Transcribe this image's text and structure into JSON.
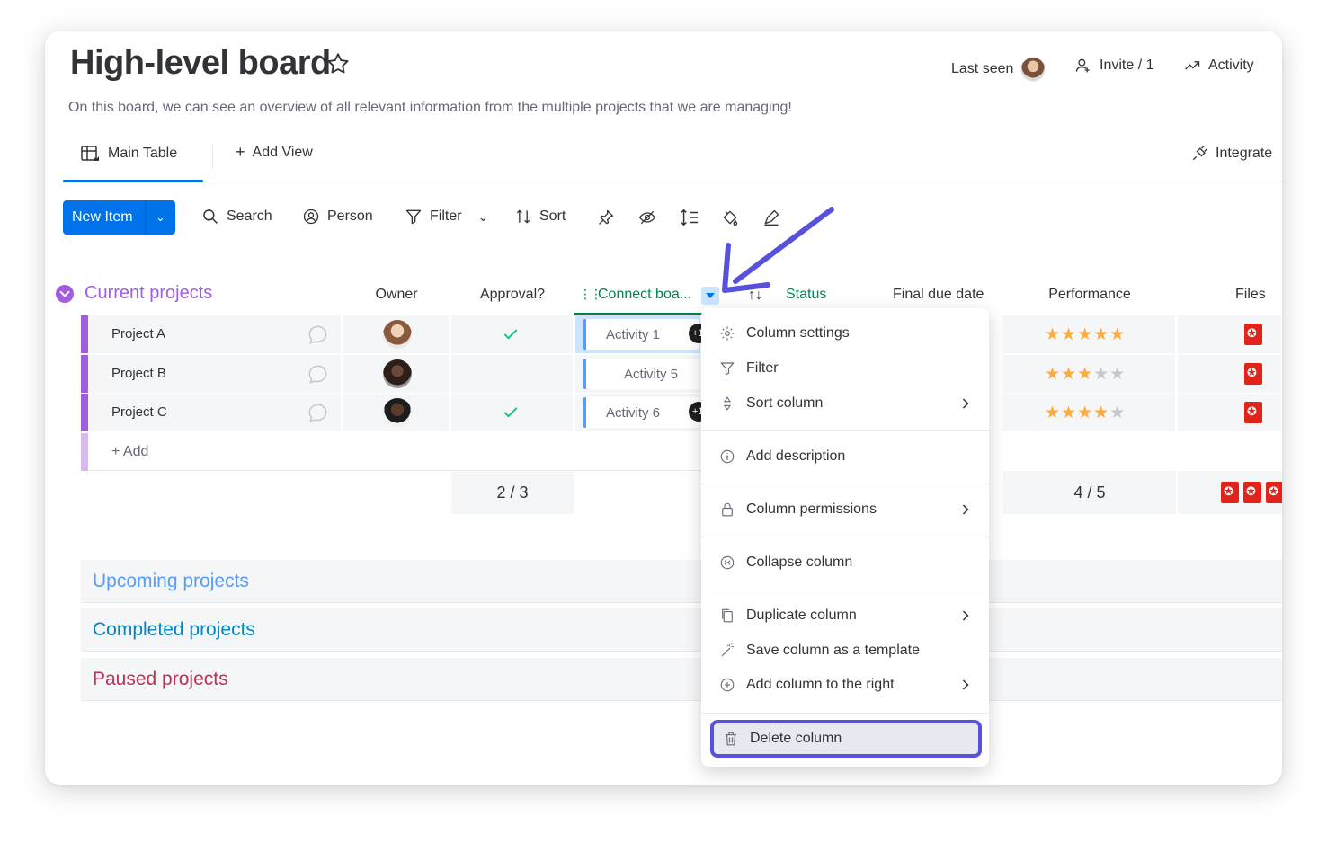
{
  "board": {
    "title": "High-level board",
    "description": "On this board, we can see an overview of all relevant information from the multiple projects that we are managing!"
  },
  "header": {
    "last_seen": "Last seen",
    "invite": "Invite / 1",
    "activity": "Activity",
    "integrate": "Integrate"
  },
  "tabs": {
    "main_table": "Main Table",
    "add_view": "Add View"
  },
  "toolbar": {
    "new_item": "New Item",
    "search": "Search",
    "person": "Person",
    "filter": "Filter",
    "sort": "Sort"
  },
  "group": {
    "title": "Current projects",
    "color": "#a25ddc",
    "add_label": "+ Add"
  },
  "columns": {
    "owner": "Owner",
    "approval": "Approval?",
    "connect": "Connect boa...",
    "status": "Status",
    "due": "Final due date",
    "performance": "Performance",
    "files": "Files"
  },
  "rows": [
    {
      "name": "Project A",
      "approved": true,
      "activity": "Activity 1",
      "extra_badge": "+1",
      "rating": 5
    },
    {
      "name": "Project B",
      "approved": false,
      "activity": "Activity 5",
      "extra_badge": "",
      "rating": 3
    },
    {
      "name": "Project C",
      "approved": true,
      "activity": "Activity 6",
      "extra_badge": "+1",
      "rating": 4
    }
  ],
  "summary": {
    "approval": "2 / 3",
    "performance": "4 / 5"
  },
  "other_groups": [
    {
      "title": "Upcoming projects",
      "color": "#579bfc"
    },
    {
      "title": "Completed projects",
      "color": "#0086c0"
    },
    {
      "title": "Paused projects",
      "color": "#bb3354"
    }
  ],
  "menu": {
    "column_settings": "Column settings",
    "filter": "Filter",
    "sort_column": "Sort column",
    "add_description": "Add description",
    "column_permissions": "Column permissions",
    "collapse_column": "Collapse column",
    "duplicate_column": "Duplicate column",
    "save_template": "Save column as a template",
    "add_right": "Add column to the right",
    "delete_column": "Delete column"
  },
  "colors": {
    "primary": "#0073ea",
    "highlight": "#5851db",
    "connect_green": "#00854d",
    "star": "#fdab3d"
  }
}
